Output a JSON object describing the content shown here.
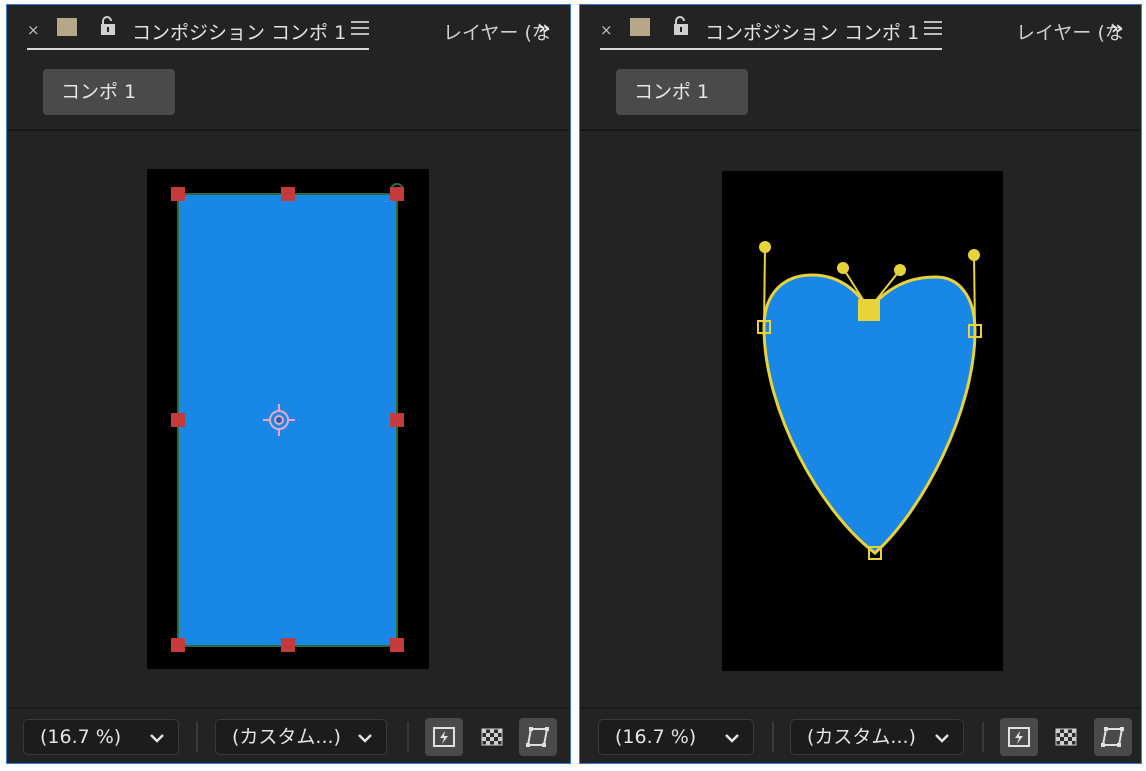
{
  "panels": [
    {
      "id": "left",
      "tab": {
        "close_label": "×",
        "title": "コンポジション コンポ 1",
        "layer_tab_label": "レイヤー (な",
        "more_label": "»",
        "close_icon": "close-icon",
        "swatch_color": "#b7a78a",
        "lock_icon": "unlock-icon",
        "menu_icon": "hamburger-menu-icon"
      },
      "breadcrumb": {
        "label": "コンポ 1"
      },
      "viewer": {
        "canvas_color": "#000000",
        "shape": "rectangle",
        "fill_color": "#1987e6",
        "handle_color": "#c53a3a",
        "anchor_icon": "anchor-point-icon"
      },
      "bottom": {
        "zoom_value": "(16.7 %)",
        "resolution_value": "(カスタム...)",
        "icons": [
          "fast-preview-icon",
          "transparency-grid-icon",
          "mask-visibility-icon"
        ]
      }
    },
    {
      "id": "right",
      "tab": {
        "close_label": "×",
        "title": "コンポジション コンポ 1",
        "layer_tab_label": "レイヤー (な",
        "more_label": "»",
        "close_icon": "close-icon",
        "swatch_color": "#b7a78a",
        "lock_icon": "unlock-icon",
        "menu_icon": "hamburger-menu-icon"
      },
      "breadcrumb": {
        "label": "コンポ 1"
      },
      "viewer": {
        "canvas_color": "#000000",
        "shape": "heart",
        "fill_color": "#1987e6",
        "path_color": "#e8d33a"
      },
      "bottom": {
        "zoom_value": "(16.7 %)",
        "resolution_value": "(カスタム...)",
        "icons": [
          "fast-preview-icon",
          "transparency-grid-icon",
          "mask-visibility-icon"
        ]
      }
    }
  ]
}
